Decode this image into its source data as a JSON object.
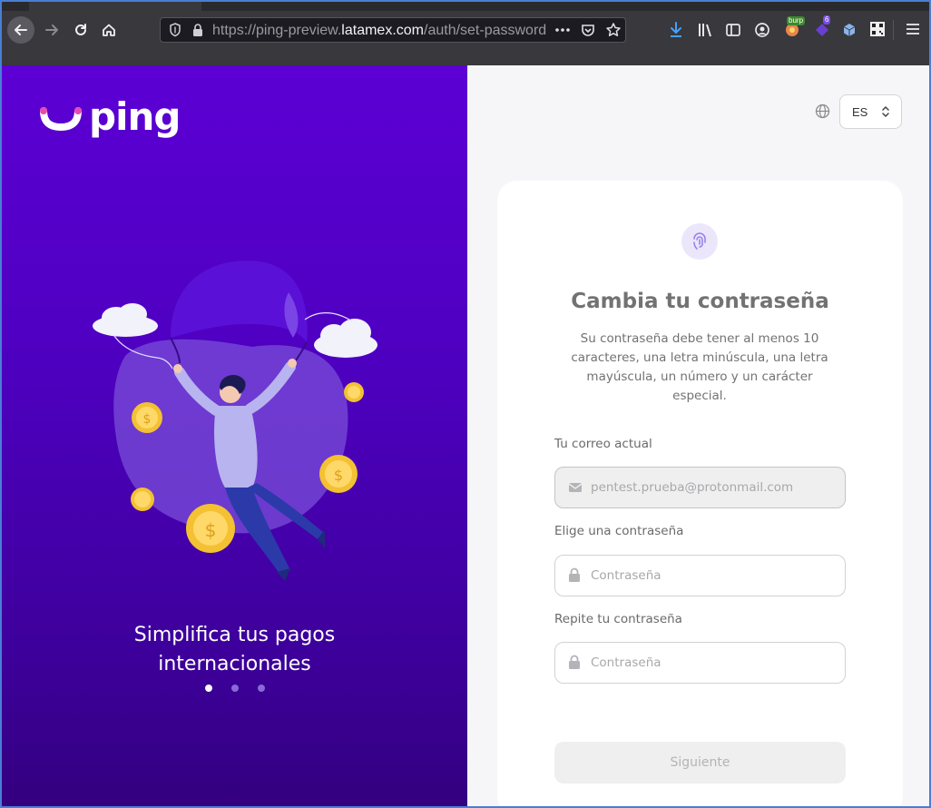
{
  "browser": {
    "url_prefix": "https://ping-preview.",
    "url_domain": "latamex.com",
    "url_path": "/auth/set-password",
    "ext_burp_badge": "burp",
    "ext_count_badge": "6"
  },
  "brand": {
    "logo_text": "ping",
    "primary": "#5c00d4",
    "accent": "#e64ab0"
  },
  "carousel": {
    "title_line1": "Simplifica tus pagos",
    "title_line2": "internacionales",
    "active_index": 0,
    "total": 3
  },
  "language": {
    "selected": "ES"
  },
  "form": {
    "title": "Cambia tu contraseña",
    "description": "Su contraseña debe tener al menos 10 caracteres, una letra minúscula, una letra mayúscula, un número y un carácter especial.",
    "email_label": "Tu correo actual",
    "email_value": "pentest.prueba@protonmail.com",
    "password_label": "Elige una contraseña",
    "password_placeholder": "Contraseña",
    "repeat_label": "Repite tu contraseña",
    "repeat_placeholder": "Contraseña",
    "submit_label": "Siguiente"
  }
}
